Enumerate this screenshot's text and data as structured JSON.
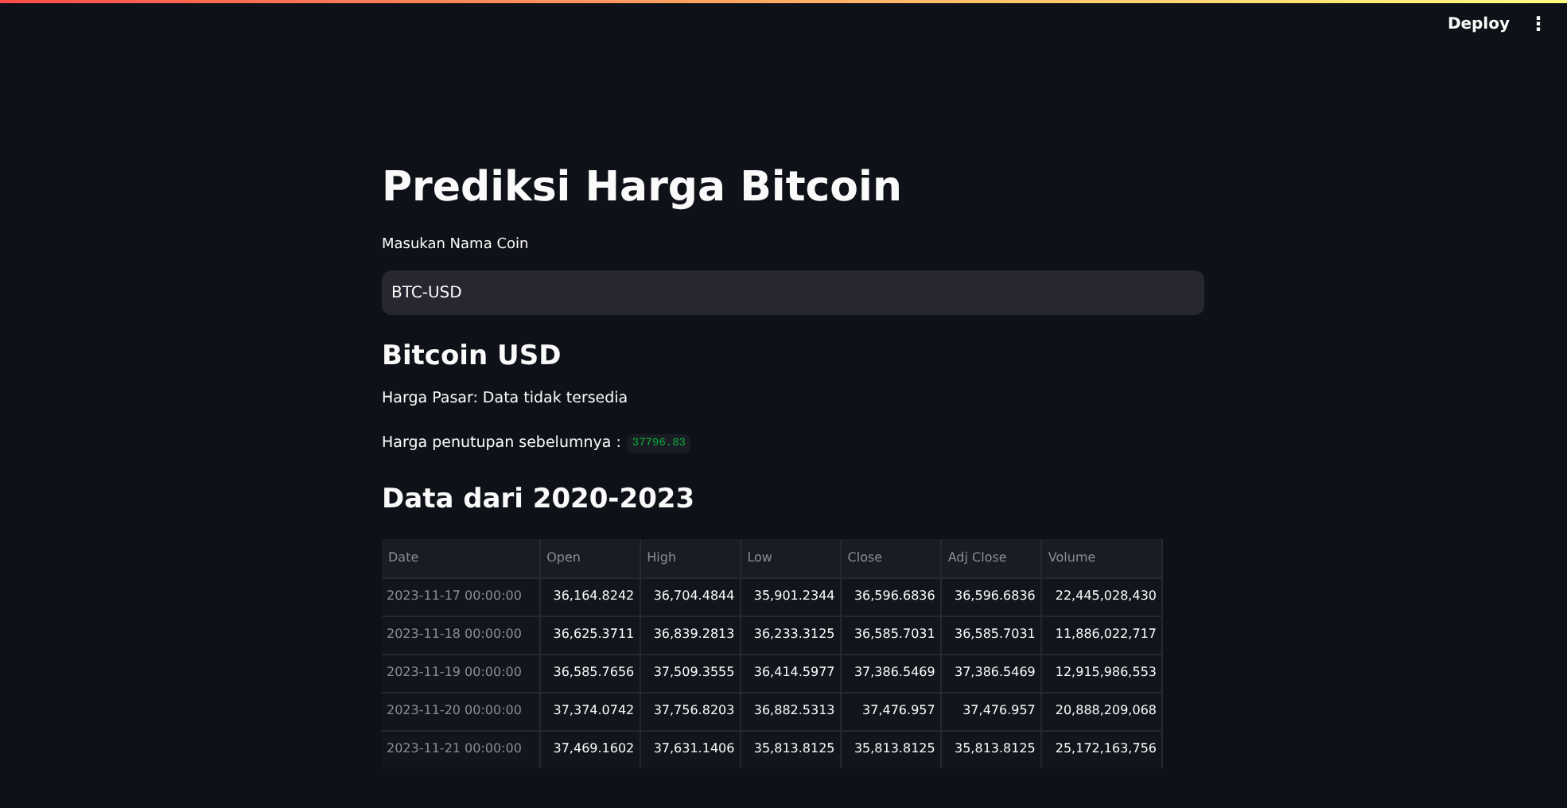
{
  "header": {
    "deploy": "Deploy",
    "menu": "⋮"
  },
  "title": "Prediksi Harga Bitcoin",
  "input": {
    "label": "Masukan Nama Coin",
    "value": "BTC-USD"
  },
  "coin_heading": "Bitcoin USD",
  "market_price": "Harga Pasar: Data tidak tersedia",
  "previous_close": {
    "label": "Harga penutupan sebelumnya :",
    "value": "37796.83"
  },
  "data_heading": "Data dari 2020-2023",
  "table": {
    "columns": [
      "Date",
      "Open",
      "High",
      "Low",
      "Close",
      "Adj Close",
      "Volume"
    ],
    "rows": [
      [
        "2023-11-17 00:00:00",
        "36,164.8242",
        "36,704.4844",
        "35,901.2344",
        "36,596.6836",
        "36,596.6836",
        "22,445,028,430"
      ],
      [
        "2023-11-18 00:00:00",
        "36,625.3711",
        "36,839.2813",
        "36,233.3125",
        "36,585.7031",
        "36,585.7031",
        "11,886,022,717"
      ],
      [
        "2023-11-19 00:00:00",
        "36,585.7656",
        "37,509.3555",
        "36,414.5977",
        "37,386.5469",
        "37,386.5469",
        "12,915,986,553"
      ],
      [
        "2023-11-20 00:00:00",
        "37,374.0742",
        "37,756.8203",
        "36,882.5313",
        "37,476.957",
        "37,476.957",
        "20,888,209,068"
      ],
      [
        "2023-11-21 00:00:00",
        "37,469.1602",
        "37,631.1406",
        "35,813.8125",
        "35,813.8125",
        "35,813.8125",
        "25,172,163,756"
      ]
    ]
  }
}
